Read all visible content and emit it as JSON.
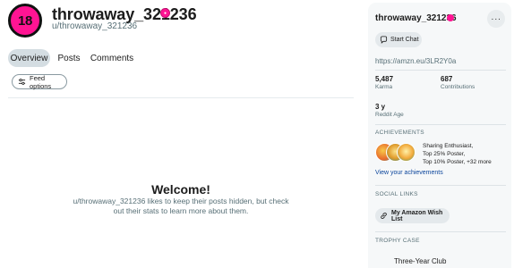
{
  "profile": {
    "avatar_text": "18",
    "display_name": "throwaway_321236",
    "handle": "u/throwaway_321236",
    "avatar_color": "#ff1493"
  },
  "tabs": [
    {
      "label": "Overview",
      "active": true
    },
    {
      "label": "Posts",
      "active": false
    },
    {
      "label": "Comments",
      "active": false
    }
  ],
  "feed_options_label": "Feed options",
  "welcome": {
    "title": "Welcome!",
    "body": "u/throwaway_321236 likes to keep their posts hidden, but check out their stats to learn more about them."
  },
  "sidebar": {
    "name": "throwaway_321236",
    "more_label": "···",
    "start_chat_label": "Start Chat",
    "link": "https://amzn.eu/3LR2Y0a",
    "stats": [
      {
        "value": "5,487",
        "label": "Karma"
      },
      {
        "value": "687",
        "label": "Contributions"
      },
      {
        "value": "3 y",
        "label": "Reddit Age"
      }
    ],
    "achievements": {
      "heading": "ACHIEVEMENTS",
      "lines": [
        "Sharing Enthusiast,",
        "Top 25% Poster,",
        "Top 10% Poster, +32 more"
      ],
      "link": "View your achievements"
    },
    "social_links": {
      "heading": "SOCIAL LINKS",
      "items": [
        {
          "label": "My Amazon Wish List",
          "icon": "link-icon"
        }
      ]
    },
    "trophy_case": {
      "heading": "TROPHY CASE",
      "items": [
        "Three-Year Club"
      ]
    }
  },
  "icons": {
    "feed_options": "sliders-icon",
    "start_chat": "chat-bubble-icon",
    "more": "ellipsis-icon",
    "name_badge": "snoo-badge-icon"
  }
}
